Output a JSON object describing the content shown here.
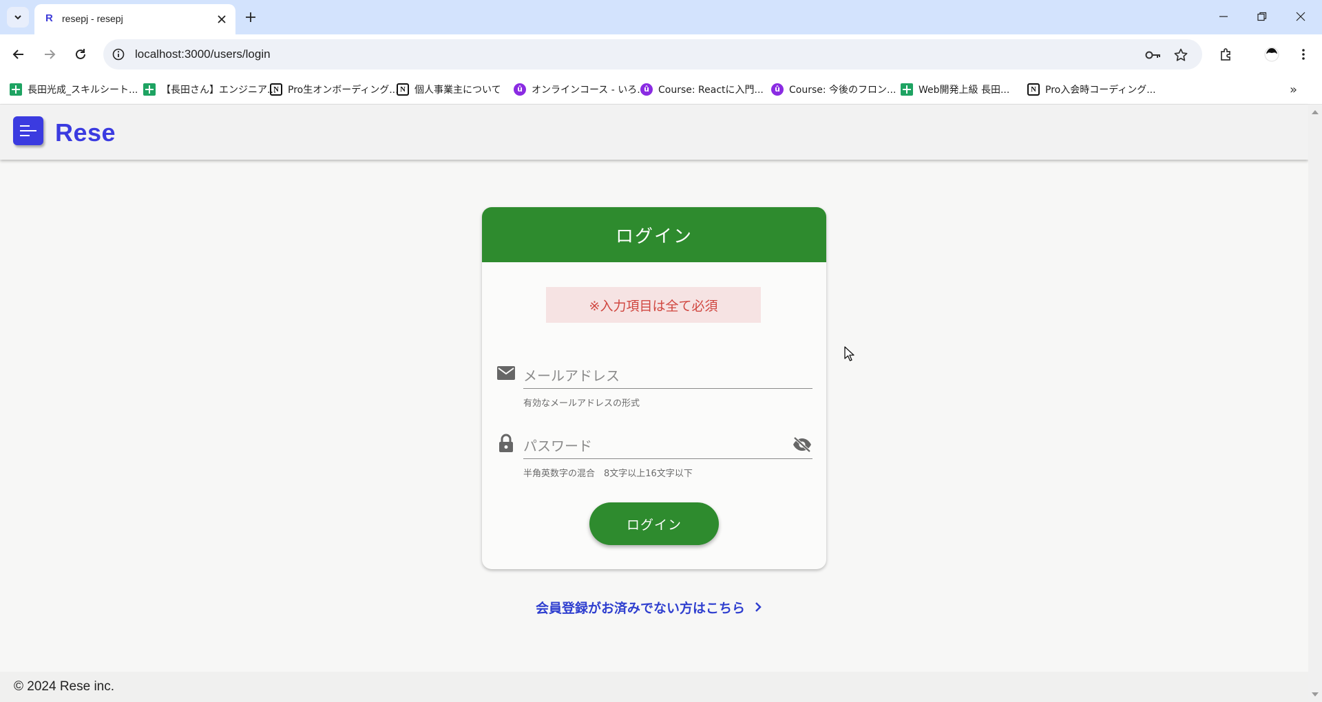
{
  "browser": {
    "tab": {
      "favicon": "R",
      "title": "resepj - resepj"
    },
    "url": "localhost:3000/users/login",
    "bookmarks": [
      {
        "icon": "sheets-icon",
        "label": "長田光成_スキルシート..."
      },
      {
        "icon": "sheets-icon",
        "label": "【長田さん】エンジニア..."
      },
      {
        "icon": "notion-icon",
        "label": "Pro生オンボーディング..."
      },
      {
        "icon": "notion-icon",
        "label": "個人事業主について"
      },
      {
        "icon": "udemy-icon",
        "label": "オンラインコース - いろ..."
      },
      {
        "icon": "udemy-icon",
        "label": "Course: Reactに入門..."
      },
      {
        "icon": "udemy-icon",
        "label": "Course: 今後のフロン..."
      },
      {
        "icon": "sheets-icon",
        "label": "Web開発上級 長田..."
      },
      {
        "icon": "notion-icon",
        "label": "Pro入会時コーディング..."
      }
    ],
    "more_bookmarks": "»"
  },
  "app": {
    "brand": "Rese",
    "brand_color": "#3b3be0",
    "accent_color": "#2e8b2e"
  },
  "login": {
    "title": "ログイン",
    "alert": "※入力項目は全て必須",
    "email": {
      "placeholder": "メールアドレス",
      "hint": "有効なメールアドレスの形式"
    },
    "password": {
      "placeholder": "パスワード",
      "hint": "半角英数字の混合　8文字以上16文字以下"
    },
    "submit_label": "ログイン",
    "register_link": "会員登録がお済みでない方はこちら"
  },
  "footer": {
    "copyright": "© 2024 Rese inc."
  }
}
